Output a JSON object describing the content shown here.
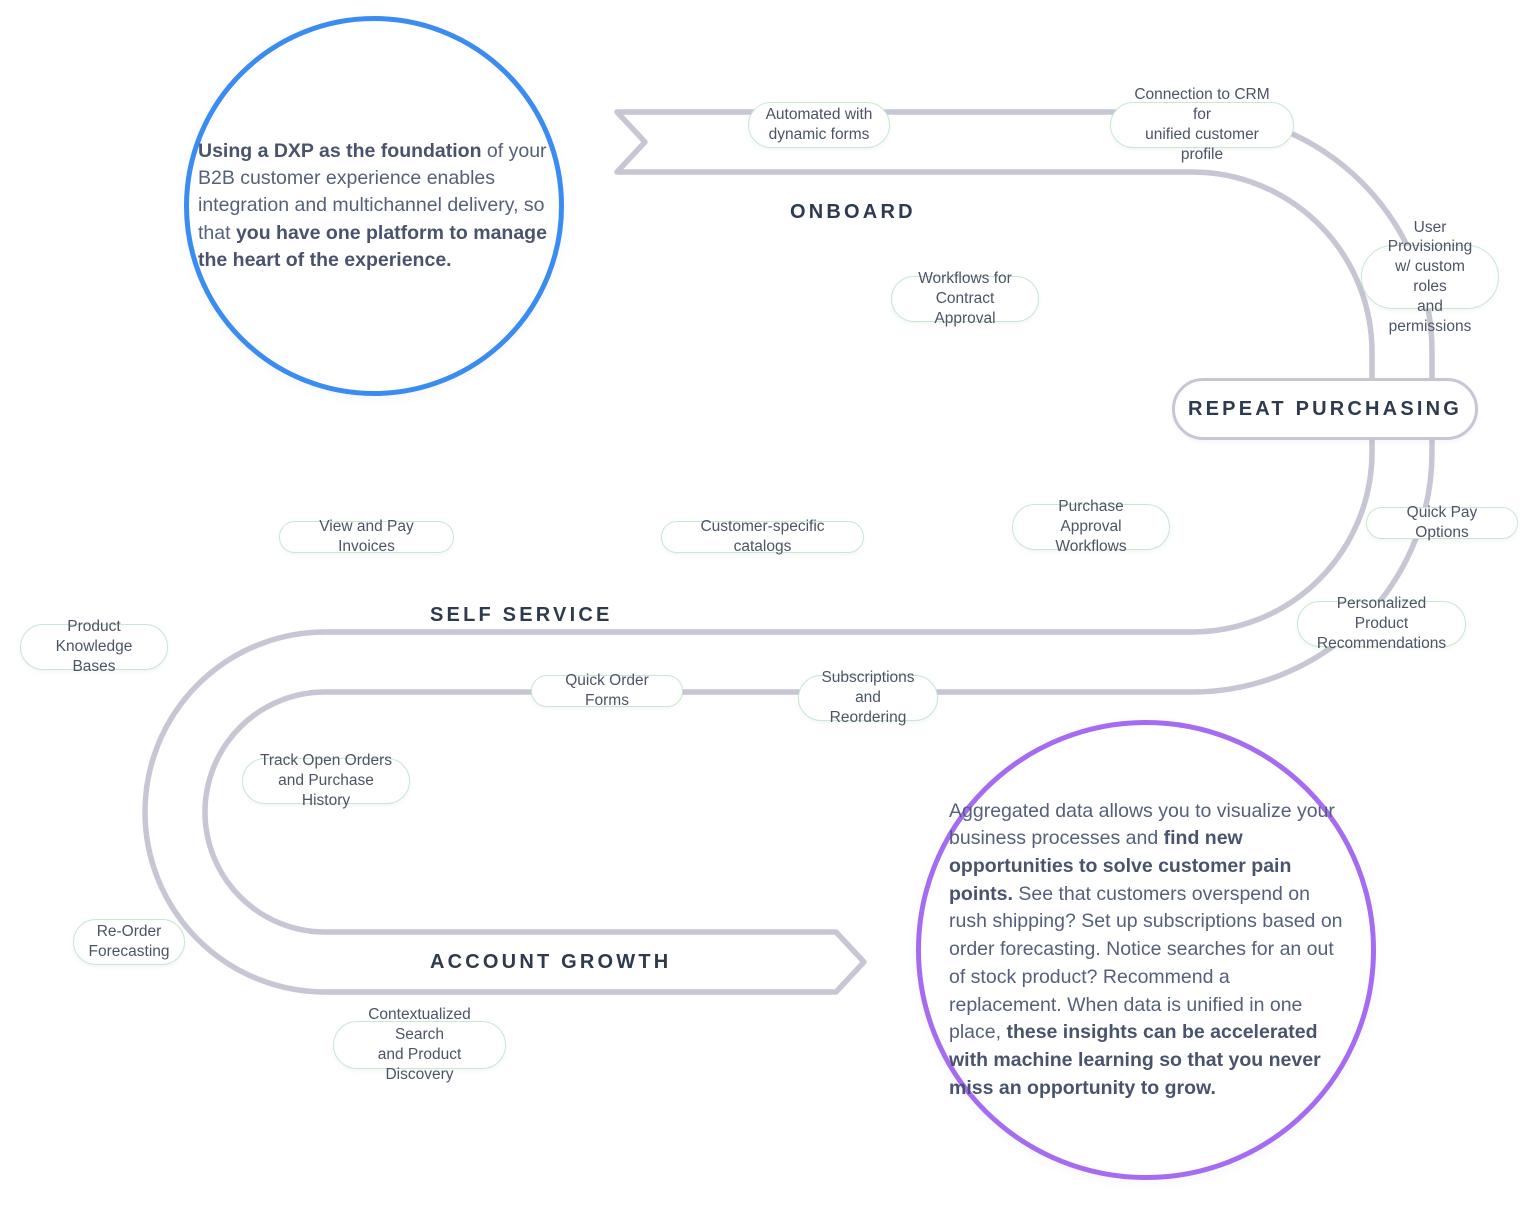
{
  "diagram": {
    "title": "B2B Customer Experience Journey Ribbon",
    "colors": {
      "ribbon_stroke": "#c6c6d4",
      "pill_border": "#c9e8d2",
      "pill_text": "#4c5565",
      "stage_text": "#2e3b4e",
      "callout_blue": "#3b8cf0",
      "callout_purple": "#a56bf0",
      "callout_text": "#55607a",
      "background": "#ffffff"
    }
  },
  "stages": [
    {
      "key": "onboard",
      "label": "ONBOARD"
    },
    {
      "key": "repeat_purchasing",
      "label": "REPEAT PURCHASING"
    },
    {
      "key": "self_service",
      "label": "SELF SERVICE"
    },
    {
      "key": "account_growth",
      "label": "ACCOUNT GROWTH"
    }
  ],
  "pills": [
    {
      "key": "automated-dynamic-forms",
      "label": "Automated with\ndynamic forms"
    },
    {
      "key": "connection-to-crm",
      "label": "Connection to CRM for\nunified customer profile"
    },
    {
      "key": "workflows-contract-approval",
      "label": "Workflows for\nContract Approval"
    },
    {
      "key": "user-provisioning",
      "label": "User Provisioning\nw/ custom roles\nand permissions"
    },
    {
      "key": "purchase-approval-workflows",
      "label": "Purchase Approval\nWorkflows"
    },
    {
      "key": "quick-pay-options",
      "label": "Quick Pay Options"
    },
    {
      "key": "view-and-pay-invoices",
      "label": "View and Pay Invoices"
    },
    {
      "key": "customer-specific-catalogs",
      "label": "Customer-specific catalogs"
    },
    {
      "key": "personalized-product-recs",
      "label": "Personalized Product\nRecommendations"
    },
    {
      "key": "product-knowledge-bases",
      "label": "Product\nKnowledge Bases"
    },
    {
      "key": "quick-order-forms",
      "label": "Quick Order Forms"
    },
    {
      "key": "subscriptions-and-reordering",
      "label": "Subscriptions\nand Reordering"
    },
    {
      "key": "track-open-orders",
      "label": "Track Open Orders\nand Purchase History"
    },
    {
      "key": "re-order-forecasting",
      "label": "Re-Order\nForecasting"
    },
    {
      "key": "contextualized-search",
      "label": "Contextualized Search\nand Product Discovery"
    }
  ],
  "callouts": {
    "blue": {
      "segments": [
        {
          "text": "Using a DXP as the foundation",
          "bold": true
        },
        {
          "text": " of your B2B customer experience enables integration and multichannel delivery, so that ",
          "bold": false
        },
        {
          "text": "you have one platform to manage the heart of the experience.",
          "bold": true
        }
      ],
      "plain": "Using a DXP as the foundation of your B2B customer experience enables integration and multichannel delivery, so that you have one platform to manage the heart of the experience."
    },
    "purple": {
      "segments": [
        {
          "text": "Aggregated data allows you to visualize your business processes and ",
          "bold": false
        },
        {
          "text": "find new opportunities to solve customer pain points.",
          "bold": true
        },
        {
          "text": " See that customers overspend on rush shipping? Set up subscriptions based on order forecasting. Notice searches for an out of stock product? Recommend a replacement. When data is unified in one place, ",
          "bold": false
        },
        {
          "text": "these insights can be accelerated with machine learning so that you never miss an opportunity to grow.",
          "bold": true
        }
      ],
      "plain": "Aggregated data allows you to visualize your business processes and find new opportunities to solve customer pain points. See that customers overspend on rush shipping? Set up subscriptions based on order forecasting. Notice searches for an out of stock product? Recommend a replacement. When data is unified in one place, these insights can be accelerated with machine learning so that you never miss an opportunity to grow."
    }
  }
}
